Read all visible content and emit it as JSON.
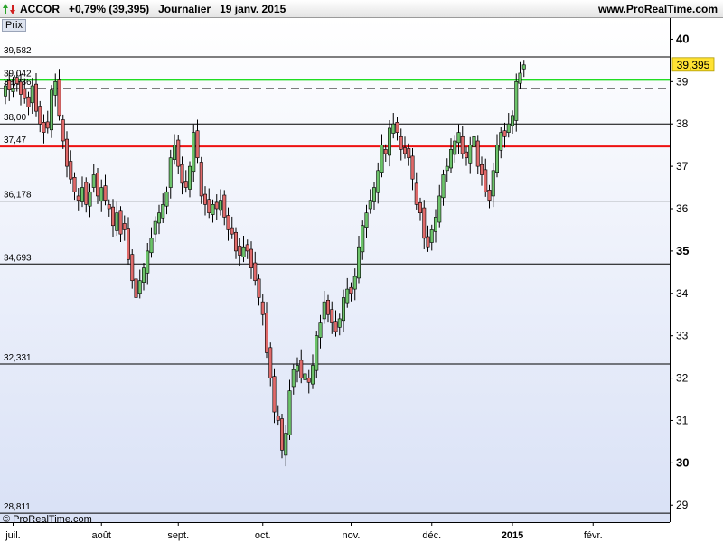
{
  "header": {
    "title": "ACCOR   +0,79% (39,395)   Journalier   19 janv. 2015",
    "brand": "www.ProRealTime.com",
    "logo_icon": "up-down-arrows-icon",
    "panel_label": "Prix"
  },
  "footer": {
    "copyright": "© ProRealTime.com"
  },
  "colors": {
    "up": "#6cc36a",
    "down": "#e06a6a",
    "support": "#22dd22",
    "resistance": "#ee1111",
    "price_tag": "#ffe233",
    "bg_top": "#ffffff",
    "bg_bottom": "#d9e1f6"
  },
  "chart_data": {
    "type": "candlestick",
    "title": "ACCOR",
    "period": "Journalier",
    "ylim": [
      28.6,
      40.5
    ],
    "y_ticks": [
      29,
      30,
      31,
      32,
      33,
      34,
      35,
      36,
      37,
      38,
      39,
      40
    ],
    "y_ticks_bold": [
      30,
      35,
      40
    ],
    "x_labels": [
      {
        "label": "juil.",
        "i": 2
      },
      {
        "label": "août",
        "i": 25
      },
      {
        "label": "sept.",
        "i": 45
      },
      {
        "label": "oct.",
        "i": 67
      },
      {
        "label": "nov.",
        "i": 90
      },
      {
        "label": "déc.",
        "i": 111
      },
      {
        "label": "2015",
        "i": 132,
        "bold": true
      },
      {
        "label": "févr.",
        "i": 153
      }
    ],
    "last_price": {
      "label": "39,395",
      "value": 39.395
    },
    "levels": [
      {
        "label": "39,582",
        "value": 39.582,
        "color": "#000000",
        "style": "solid"
      },
      {
        "label": "39,042",
        "value": 39.042,
        "color": "#22dd22",
        "style": "solid"
      },
      {
        "label": "38,836",
        "value": 38.836,
        "color": "#000000",
        "style": "dashed"
      },
      {
        "label": "38,00",
        "value": 38.0,
        "color": "#000000",
        "style": "solid"
      },
      {
        "label": "37,47",
        "value": 37.47,
        "color": "#ee1111",
        "style": "solid"
      },
      {
        "label": "36,178",
        "value": 36.178,
        "color": "#000000",
        "style": "solid"
      },
      {
        "label": "34,693",
        "value": 34.693,
        "color": "#000000",
        "style": "solid"
      },
      {
        "label": "32,331",
        "value": 32.331,
        "color": "#000000",
        "style": "solid"
      },
      {
        "label": "28,811",
        "value": 28.811,
        "color": "#000000",
        "style": "solid"
      }
    ],
    "close": [
      38.9,
      38.8,
      38.85,
      38.95,
      38.7,
      38.6,
      38.4,
      38.9,
      38.3,
      38.0,
      37.8,
      37.9,
      38.8,
      39.0,
      38.2,
      37.6,
      37.0,
      36.7,
      36.4,
      36.2,
      36.5,
      36.1,
      36.4,
      36.8,
      36.3,
      36.5,
      36.2,
      36.0,
      35.6,
      35.9,
      35.4,
      35.5,
      34.8,
      34.3,
      33.9,
      34.3,
      34.6,
      35.0,
      35.3,
      35.7,
      35.9,
      36.1,
      36.4,
      37.2,
      37.5,
      37.0,
      36.6,
      36.5,
      37.0,
      37.8,
      37.2,
      36.3,
      36.1,
      35.9,
      36.1,
      36.0,
      36.2,
      35.8,
      35.5,
      35.4,
      35.0,
      34.9,
      35.1,
      35.0,
      34.6,
      34.3,
      33.9,
      33.5,
      32.6,
      32.0,
      31.2,
      31.0,
      30.3,
      30.7,
      31.7,
      32.2,
      32.3,
      32.0,
      32.1,
      31.9,
      32.3,
      33.0,
      33.3,
      33.8,
      33.5,
      33.3,
      33.1,
      33.4,
      33.9,
      34.1,
      34.0,
      34.4,
      35.1,
      35.6,
      35.9,
      36.2,
      36.5,
      36.9,
      37.5,
      37.3,
      37.9,
      38.0,
      37.8,
      37.4,
      37.3,
      37.2,
      36.7,
      36.1,
      35.9,
      35.3,
      35.1,
      35.5,
      35.8,
      36.3,
      36.8,
      37.0,
      37.4,
      37.6,
      37.8,
      37.3,
      37.2,
      37.5,
      37.7,
      37.0,
      36.8,
      36.4,
      36.2,
      36.9,
      37.5,
      37.8,
      37.7,
      38.0,
      38.2,
      39.0,
      39.2,
      39.395
    ]
  }
}
